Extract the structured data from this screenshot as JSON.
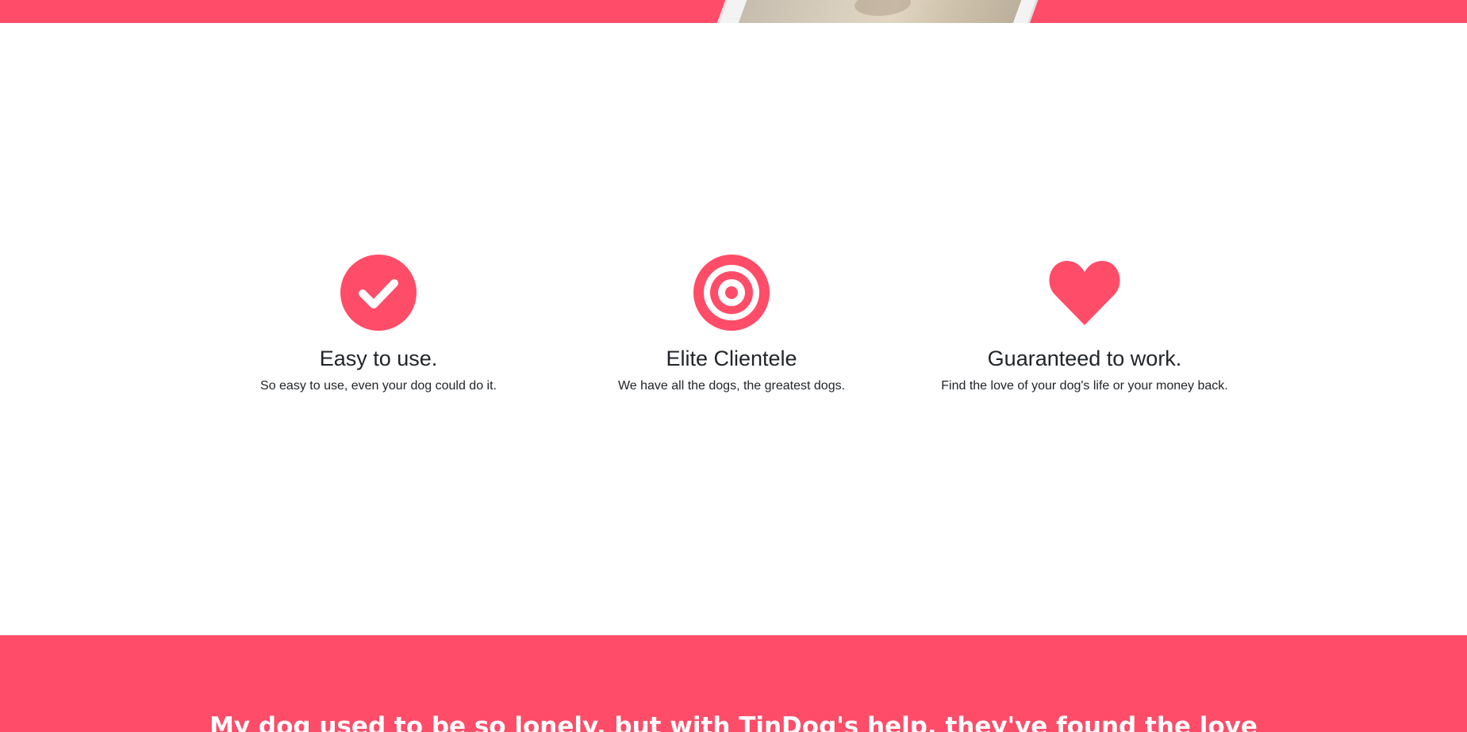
{
  "colors": {
    "accent": "#ff4c68",
    "text": "#212529",
    "background": "#ffffff"
  },
  "features": [
    {
      "icon": "check-circle-icon",
      "title": "Easy to use.",
      "text": "So easy to use, even your dog could do it."
    },
    {
      "icon": "bullseye-icon",
      "title": "Elite Clientele",
      "text": "We have all the dogs, the greatest dogs."
    },
    {
      "icon": "heart-icon",
      "title": "Guaranteed to work.",
      "text": "Find the love of your dog's life or your money back."
    }
  ],
  "testimonial": {
    "quote": "My dog used to be so lonely, but with TinDog's help, they've found the love"
  }
}
